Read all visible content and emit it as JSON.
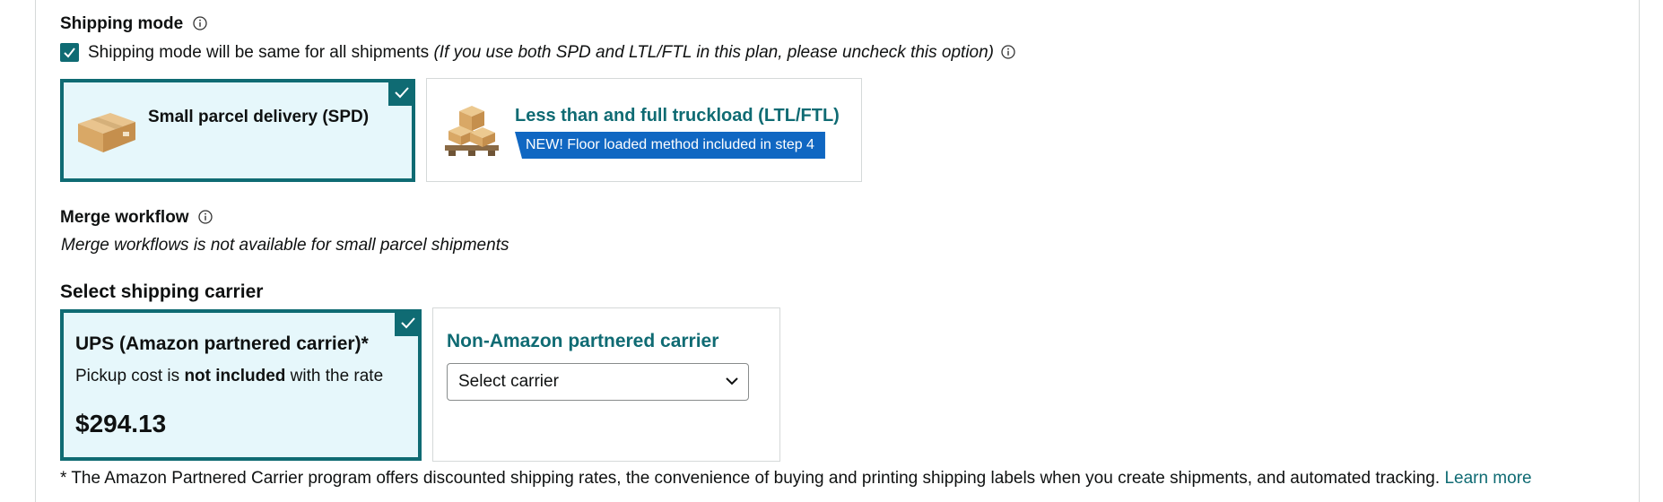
{
  "shipping_mode": {
    "title": "Shipping mode",
    "same_for_all_label": "Shipping mode will be same for all shipments",
    "same_for_all_hint": "(If you use both SPD and LTL/FTL in this plan, please uncheck this option)",
    "same_for_all_checked": true,
    "options": [
      {
        "label": "Small parcel delivery (SPD)",
        "selected": true
      },
      {
        "label": "Less than and full truckload (LTL/FTL)",
        "selected": false,
        "badge": "NEW! Floor loaded method included in step 4"
      }
    ]
  },
  "merge_workflow": {
    "title": "Merge workflow",
    "note": "Merge workflows is not available for small parcel shipments"
  },
  "carrier": {
    "title": "Select shipping carrier",
    "partnered": {
      "name": "UPS (Amazon partnered carrier)*",
      "pickup_prefix": "Pickup cost is",
      "pickup_bold": "not included",
      "pickup_suffix": "with the rate",
      "price": "$294.13",
      "selected": true
    },
    "non_partnered": {
      "name": "Non-Amazon partnered carrier",
      "select_value": "Select carrier"
    }
  },
  "footnote": {
    "text": "* The Amazon Partnered Carrier program offers discounted shipping rates, the convenience of buying and printing shipping labels when you create shipments, and automated tracking.",
    "link": "Learn more"
  },
  "colors": {
    "accent": "#0f6b73",
    "selected_bg": "#e6f7fb",
    "badge": "#1067c2"
  }
}
